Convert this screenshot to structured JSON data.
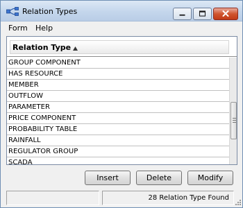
{
  "window": {
    "title": "Relation Types"
  },
  "menu": {
    "items": [
      "Form",
      "Help"
    ]
  },
  "list": {
    "column_header": "Relation Type",
    "sort_direction": "ascending",
    "rows": [
      "GROUP COMPONENT",
      "HAS RESOURCE",
      "MEMBER",
      "OUTFLOW",
      "PARAMETER",
      "PRICE COMPONENT",
      "PROBABILITY TABLE",
      "RAINFALL",
      "REGULATOR GROUP",
      "SCADA"
    ]
  },
  "buttons": {
    "insert": "Insert",
    "delete": "Delete",
    "modify": "Modify"
  },
  "status": {
    "left": "",
    "right": "28 Relation Type Found"
  },
  "colors": {
    "title_gradient_top": "#dce8f5",
    "close_button": "#c13a16",
    "window_border": "#6f8fb4"
  }
}
